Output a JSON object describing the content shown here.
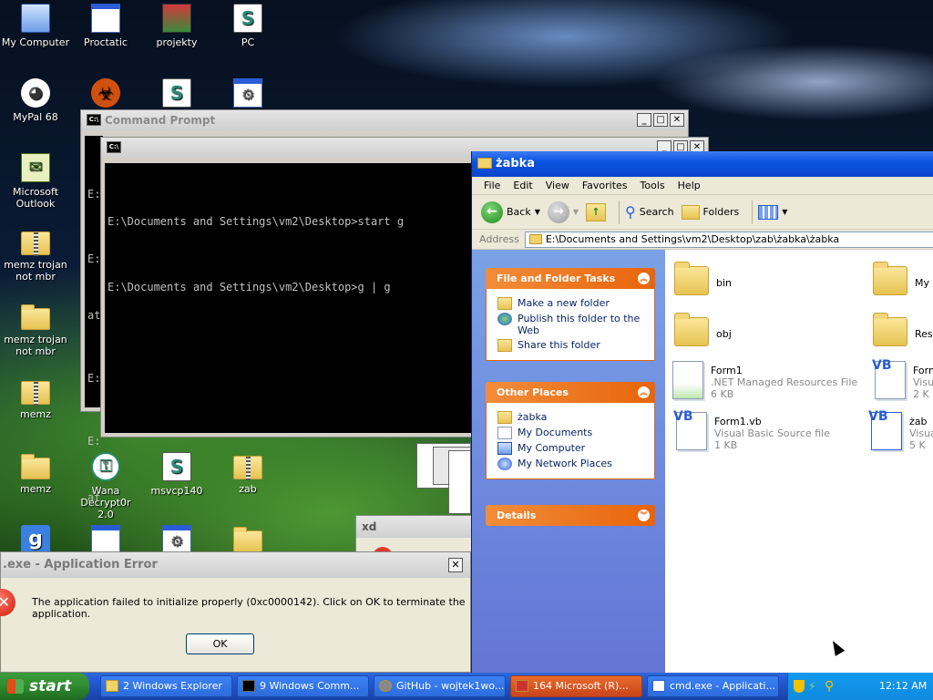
{
  "desktop_icons": [
    {
      "label": "My Computer",
      "icon": "my-computer-icon"
    },
    {
      "label": "Proctatic",
      "icon": "window-icon"
    },
    {
      "label": "projekty",
      "icon": "archive-box-icon"
    },
    {
      "label": "PC",
      "icon": "script-icon"
    },
    {
      "label": "MyPal 68",
      "icon": "mypal-icon"
    },
    {
      "label": "Microsoft Outlook",
      "icon": "outlook-icon"
    },
    {
      "label": "memz trojan not mbr",
      "icon": "zip-folder-icon"
    },
    {
      "label": "memz trojan not mbr",
      "icon": "folder-icon"
    },
    {
      "label": "memz",
      "icon": "zip-folder-icon"
    },
    {
      "label": "memz",
      "icon": "folder-icon"
    },
    {
      "label": "Wana Decrypt0r 2.0",
      "icon": "wana-icon"
    },
    {
      "label": "msvcp140",
      "icon": "script-icon"
    },
    {
      "label": "zab",
      "icon": "zip-folder-icon"
    }
  ],
  "cmd_back": {
    "title": "Command Prompt",
    "fragments": [
      "E:",
      "E:",
      "at",
      "E:",
      "E:",
      "at"
    ]
  },
  "cmd_front": {
    "lines": [
      "E:\\Documents and Settings\\vm2\\Desktop>start g",
      "E:\\Documents and Settings\\vm2\\Desktop>g | g"
    ]
  },
  "explorer": {
    "title": "żabka",
    "menu": [
      "File",
      "Edit",
      "View",
      "Favorites",
      "Tools",
      "Help"
    ],
    "toolbar": {
      "back": "Back",
      "search": "Search",
      "folders": "Folders"
    },
    "address_label": "Address",
    "address_value": "E:\\Documents and Settings\\vm2\\Desktop\\zab\\żabka\\żabka",
    "file_tasks": {
      "title": "File and Folder Tasks",
      "items": [
        "Make a new folder",
        "Publish this folder to the Web",
        "Share this folder"
      ]
    },
    "other_places": {
      "title": "Other Places",
      "items": [
        "żabka",
        "My Documents",
        "My Computer",
        "My Network Places"
      ]
    },
    "details": {
      "title": "Details"
    },
    "files": [
      {
        "name": "bin",
        "type": "",
        "size": ""
      },
      {
        "name": "My",
        "type": "",
        "size": ""
      },
      {
        "name": "obj",
        "type": "",
        "size": ""
      },
      {
        "name": "Res",
        "type": "",
        "size": ""
      },
      {
        "name": "Form1",
        "type": ".NET Managed Resources File",
        "size": "6 KB"
      },
      {
        "name": "Form",
        "type": "Visua",
        "size": "2 K"
      },
      {
        "name": "Form1.vb",
        "type": "Visual Basic Source file",
        "size": "1 KB"
      },
      {
        "name": "żab",
        "type": "Visua",
        "size": "5 K"
      }
    ]
  },
  "xd_window": {
    "title": "xd"
  },
  "error_dialog": {
    "title": ".exe - Application Error",
    "message": "The application failed to initialize properly (0xc0000142). Click on OK to terminate the application.",
    "ok": "OK"
  },
  "taskbar": {
    "start": "start",
    "items": [
      {
        "label": "2 Windows Explorer",
        "active": false
      },
      {
        "label": "9 Windows Comm...",
        "active": false
      },
      {
        "label": "GitHub - wojtek1wo...",
        "active": false
      },
      {
        "label": "164 Microsoft (R)...",
        "active": true
      },
      {
        "label": "cmd.exe - Applicati...",
        "active": false
      }
    ],
    "clock": "12:12 AM"
  }
}
